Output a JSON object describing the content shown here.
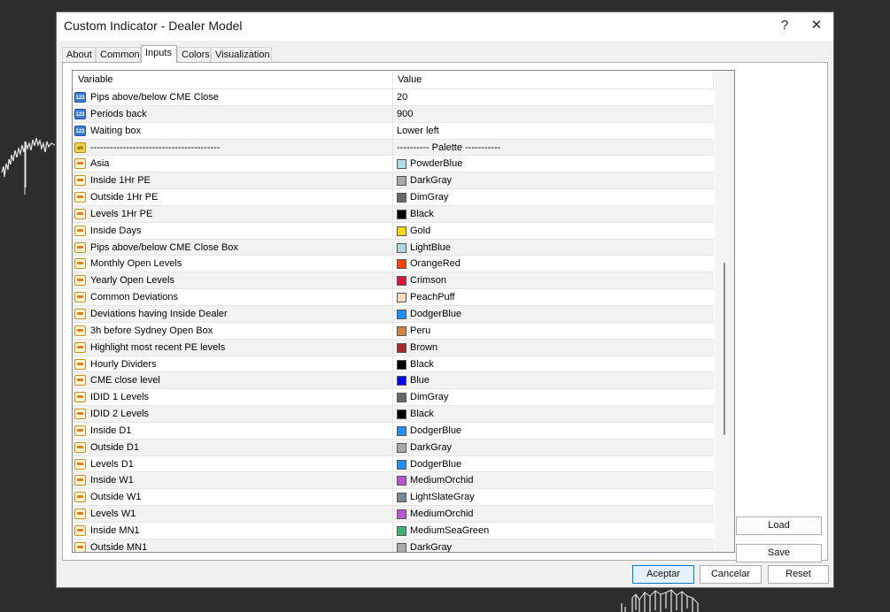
{
  "window": {
    "title": "Custom Indicator - Dealer Model",
    "help_label": "?",
    "close_label": "✕"
  },
  "tabs": [
    {
      "label": "About"
    },
    {
      "label": "Common"
    },
    {
      "label": "Inputs",
      "active": true
    },
    {
      "label": "Colors"
    },
    {
      "label": "Visualization"
    }
  ],
  "grid": {
    "col_variable": "Variable",
    "col_value": "Value",
    "rows": [
      {
        "icon": "number-icon",
        "name": "Pips above/below CME Close",
        "value": "20"
      },
      {
        "icon": "number-icon",
        "name": "Periods back",
        "value": "900"
      },
      {
        "icon": "number-icon",
        "name": "Waiting box",
        "value": "Lower left"
      },
      {
        "icon": "text-icon",
        "name": "----------------------------------------",
        "value": "----------  Palette  -----------"
      },
      {
        "icon": "color-icon",
        "name": "Asia",
        "value": "PowderBlue",
        "color": "#B0E0E6"
      },
      {
        "icon": "color-icon",
        "name": "Inside 1Hr PE",
        "value": "DarkGray",
        "color": "#A9A9A9"
      },
      {
        "icon": "color-icon",
        "name": "Outside 1Hr PE",
        "value": "DimGray",
        "color": "#696969"
      },
      {
        "icon": "color-icon",
        "name": "Levels  1Hr PE",
        "value": "Black",
        "color": "#000000"
      },
      {
        "icon": "color-icon",
        "name": "Inside Days",
        "value": "Gold",
        "color": "#FFD700"
      },
      {
        "icon": "color-icon",
        "name": "Pips above/below CME Close Box",
        "value": "LightBlue",
        "color": "#ADD8E6"
      },
      {
        "icon": "color-icon",
        "name": "Monthly Open Levels",
        "value": "OrangeRed",
        "color": "#FF4500"
      },
      {
        "icon": "color-icon",
        "name": "Yearly Open Levels",
        "value": "Crimson",
        "color": "#DC143C"
      },
      {
        "icon": "color-icon",
        "name": "Common Deviations",
        "value": "PeachPuff",
        "color": "#FFDAB9"
      },
      {
        "icon": "color-icon",
        "name": "Deviations having Inside Dealer",
        "value": "DodgerBlue",
        "color": "#1E90FF"
      },
      {
        "icon": "color-icon",
        "name": "3h before Sydney Open Box",
        "value": "Peru",
        "color": "#CD853F"
      },
      {
        "icon": "color-icon",
        "name": "Highlight most recent PE levels",
        "value": "Brown",
        "color": "#A52A2A"
      },
      {
        "icon": "color-icon",
        "name": "Hourly Dividers",
        "value": "Black",
        "color": "#000000"
      },
      {
        "icon": "color-icon",
        "name": "CME close level",
        "value": "Blue",
        "color": "#0000FF"
      },
      {
        "icon": "color-icon",
        "name": "IDID 1 Levels",
        "value": "DimGray",
        "color": "#696969"
      },
      {
        "icon": "color-icon",
        "name": "IDID 2 Levels",
        "value": "Black",
        "color": "#000000"
      },
      {
        "icon": "color-icon",
        "name": "Inside D1",
        "value": "DodgerBlue",
        "color": "#1E90FF"
      },
      {
        "icon": "color-icon",
        "name": "Outside D1",
        "value": "DarkGray",
        "color": "#A9A9A9"
      },
      {
        "icon": "color-icon",
        "name": "Levels D1",
        "value": "DodgerBlue",
        "color": "#1E90FF"
      },
      {
        "icon": "color-icon",
        "name": "Inside W1",
        "value": "MediumOrchid",
        "color": "#BA55D3"
      },
      {
        "icon": "color-icon",
        "name": "Outside W1",
        "value": "LightSlateGray",
        "color": "#778899"
      },
      {
        "icon": "color-icon",
        "name": "Levels W1",
        "value": "MediumOrchid",
        "color": "#BA55D3"
      },
      {
        "icon": "color-icon",
        "name": "Inside MN1",
        "value": "MediumSeaGreen",
        "color": "#3CB371"
      },
      {
        "icon": "color-icon",
        "name": "Outside MN1",
        "value": "DarkGray",
        "color": "#A9A9A9"
      }
    ]
  },
  "side_buttons": {
    "load": "Load",
    "save": "Save"
  },
  "footer": {
    "ok": "Aceptar",
    "cancel": "Cancelar",
    "reset": "Reset"
  }
}
